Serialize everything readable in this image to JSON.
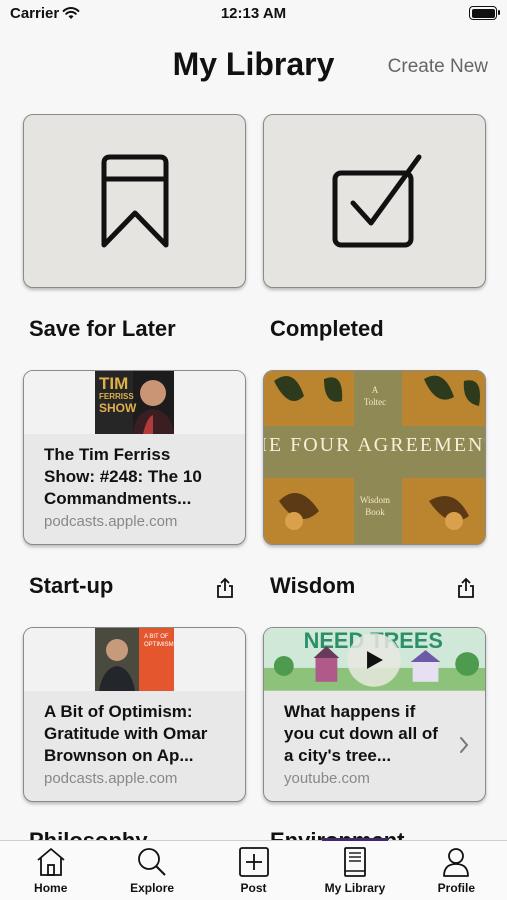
{
  "status_bar": {
    "carrier": "Carrier",
    "time": "12:13 AM"
  },
  "header": {
    "title": "My Library",
    "create_new": "Create New"
  },
  "collections": [
    {
      "label": "Save for Later",
      "icon": "bookmark-icon"
    },
    {
      "label": "Completed",
      "icon": "checkbox-icon"
    }
  ],
  "categories": [
    {
      "label": "Start-up",
      "card": {
        "title": "The Tim Ferriss Show: #248: The 10 Commandments...",
        "source": "podcasts.apple.com",
        "thumb_text": "TIM FERRISS SHOW"
      }
    },
    {
      "label": "Wisdom",
      "card": {
        "title": "THE FOUR AGREEMENTS",
        "source": "",
        "thumb_text": "A Toltec Wisdom Book"
      }
    },
    {
      "label": "Philosophy",
      "card": {
        "title": "A Bit of Optimism: Gratitude with Omar Brownson on Ap...",
        "source": "podcasts.apple.com"
      }
    },
    {
      "label": "Environment",
      "card": {
        "title": "What happens if you cut down all of a city's tree...",
        "source": "youtube.com",
        "thumb_text": "NEED TREES"
      }
    }
  ],
  "tabs": [
    {
      "label": "Home",
      "icon": "home-icon"
    },
    {
      "label": "Explore",
      "icon": "search-icon"
    },
    {
      "label": "Post",
      "icon": "plus-square-icon"
    },
    {
      "label": "My Library",
      "icon": "book-icon",
      "active": true
    },
    {
      "label": "Profile",
      "icon": "person-icon"
    }
  ],
  "colors": {
    "accent": "#3f2a6d",
    "tile_bg": "#e6e4e1"
  }
}
